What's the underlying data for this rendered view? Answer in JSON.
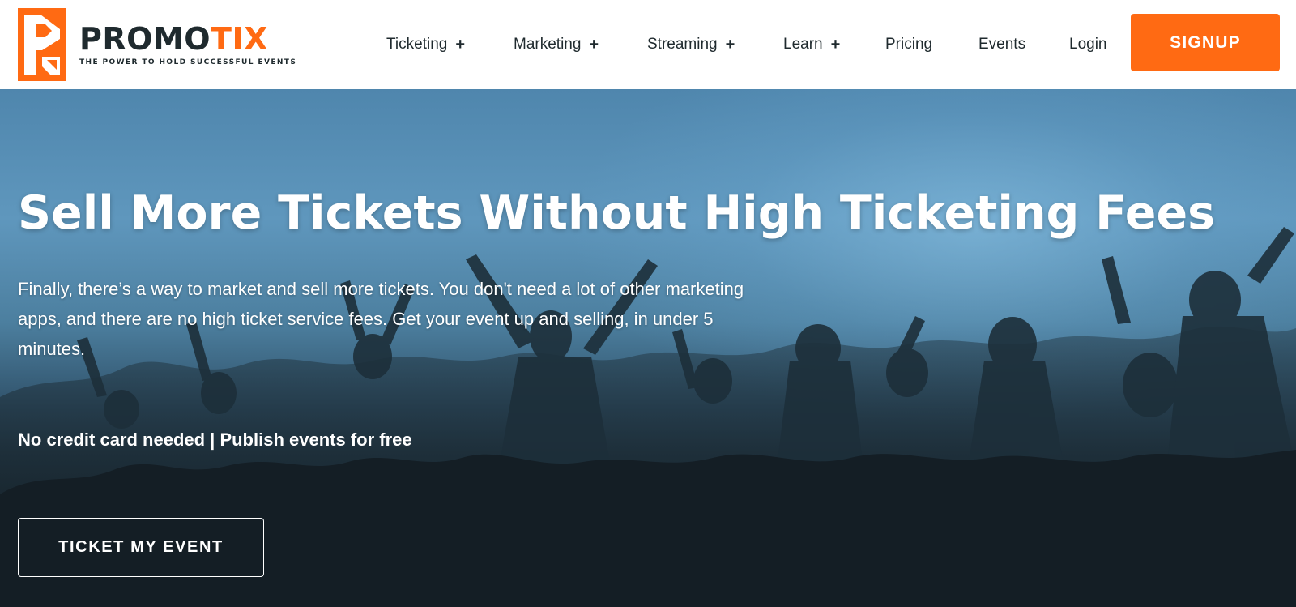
{
  "header": {
    "logo": {
      "word_dark": "PROMO",
      "word_accent": "TIX",
      "tagline": "THE POWER TO HOLD SUCCESSFUL EVENTS",
      "icon": "promotix-logo-icon"
    },
    "nav": [
      {
        "label": "Ticketing",
        "has_submenu": true,
        "submenu_icon": "+"
      },
      {
        "label": "Marketing",
        "has_submenu": true,
        "submenu_icon": "+"
      },
      {
        "label": "Streaming",
        "has_submenu": true,
        "submenu_icon": "+"
      },
      {
        "label": "Learn",
        "has_submenu": true,
        "submenu_icon": "+"
      },
      {
        "label": "Pricing",
        "has_submenu": false
      },
      {
        "label": "Events",
        "has_submenu": false
      },
      {
        "label": "Login",
        "has_submenu": false
      }
    ],
    "signup_label": "SIGNUP"
  },
  "hero": {
    "title": "Sell More Tickets Without High Ticketing Fees",
    "body": "Finally, there’s a way to market and sell more tickets. You don't need a lot of other marketing apps, and there are no high ticket service fees. Get your event up and selling, in under 5 minutes.",
    "note": "No credit card needed | Publish events for free",
    "cta_label": "TICKET MY EVENT"
  },
  "colors": {
    "accent": "#ff6a13",
    "text_dark": "#1f2a2e",
    "hero_top": "#5f97bd",
    "hero_bottom": "#151f26"
  }
}
